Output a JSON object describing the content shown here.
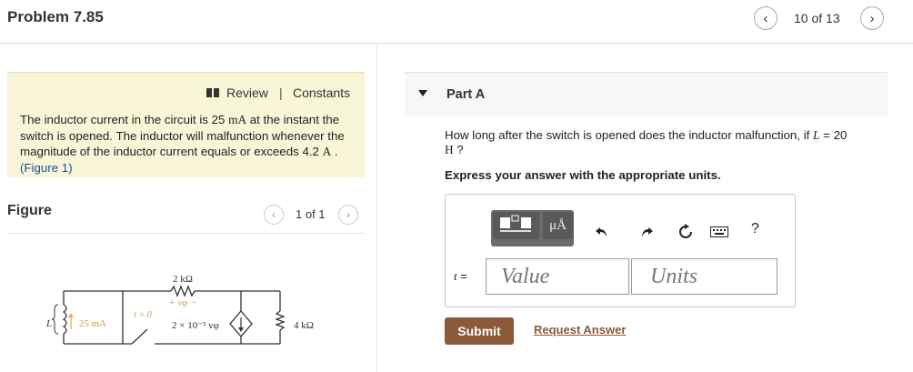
{
  "header": {
    "title": "Problem 7.85",
    "pager": "10 of 13",
    "prev_icon": "chevron-left-icon",
    "next_icon": "chevron-right-icon"
  },
  "info": {
    "review_label": "Review",
    "separator": "|",
    "constants_label": "Constants",
    "text_1": "The inductor current in the circuit is 25 ",
    "text_unit_1": "mA",
    "text_2": " at the instant the switch is opened. The inductor will malfunction whenever the magnitude of the inductor current equals or exceeds 4.2 ",
    "text_unit_2": "A",
    "text_3": " . ",
    "figure_link": "(Figure 1)"
  },
  "figure": {
    "label": "Figure",
    "pager": "1 of 1",
    "circuit": {
      "resistor_1": "2 kΩ",
      "vphi_label": "+ vφ −",
      "switch_label": "t = 0",
      "source_label": "2 × 10⁻³ vφ",
      "resistor_2": "4 kΩ",
      "inductor_label": "L",
      "current_label": "25 mA"
    }
  },
  "partA": {
    "title": "Part A",
    "question_1": "How long after the switch is opened does the inductor malfunction, if ",
    "question_var": "L",
    "question_2": " = 20",
    "question_unit": "H",
    "question_3": " ?",
    "instruction": "Express your answer with the appropriate units.",
    "toolbar": {
      "units_label": "μÅ",
      "help_label": "?"
    },
    "answer_var": "t",
    "answer_eq": " =",
    "value_placeholder": "Value",
    "units_placeholder": "Units",
    "submit_label": "Submit",
    "request_label": "Request Answer"
  },
  "colors": {
    "info_bg": "#f9f5d7",
    "submit_bg": "#8a5a3a",
    "link": "#1a4f9c"
  }
}
